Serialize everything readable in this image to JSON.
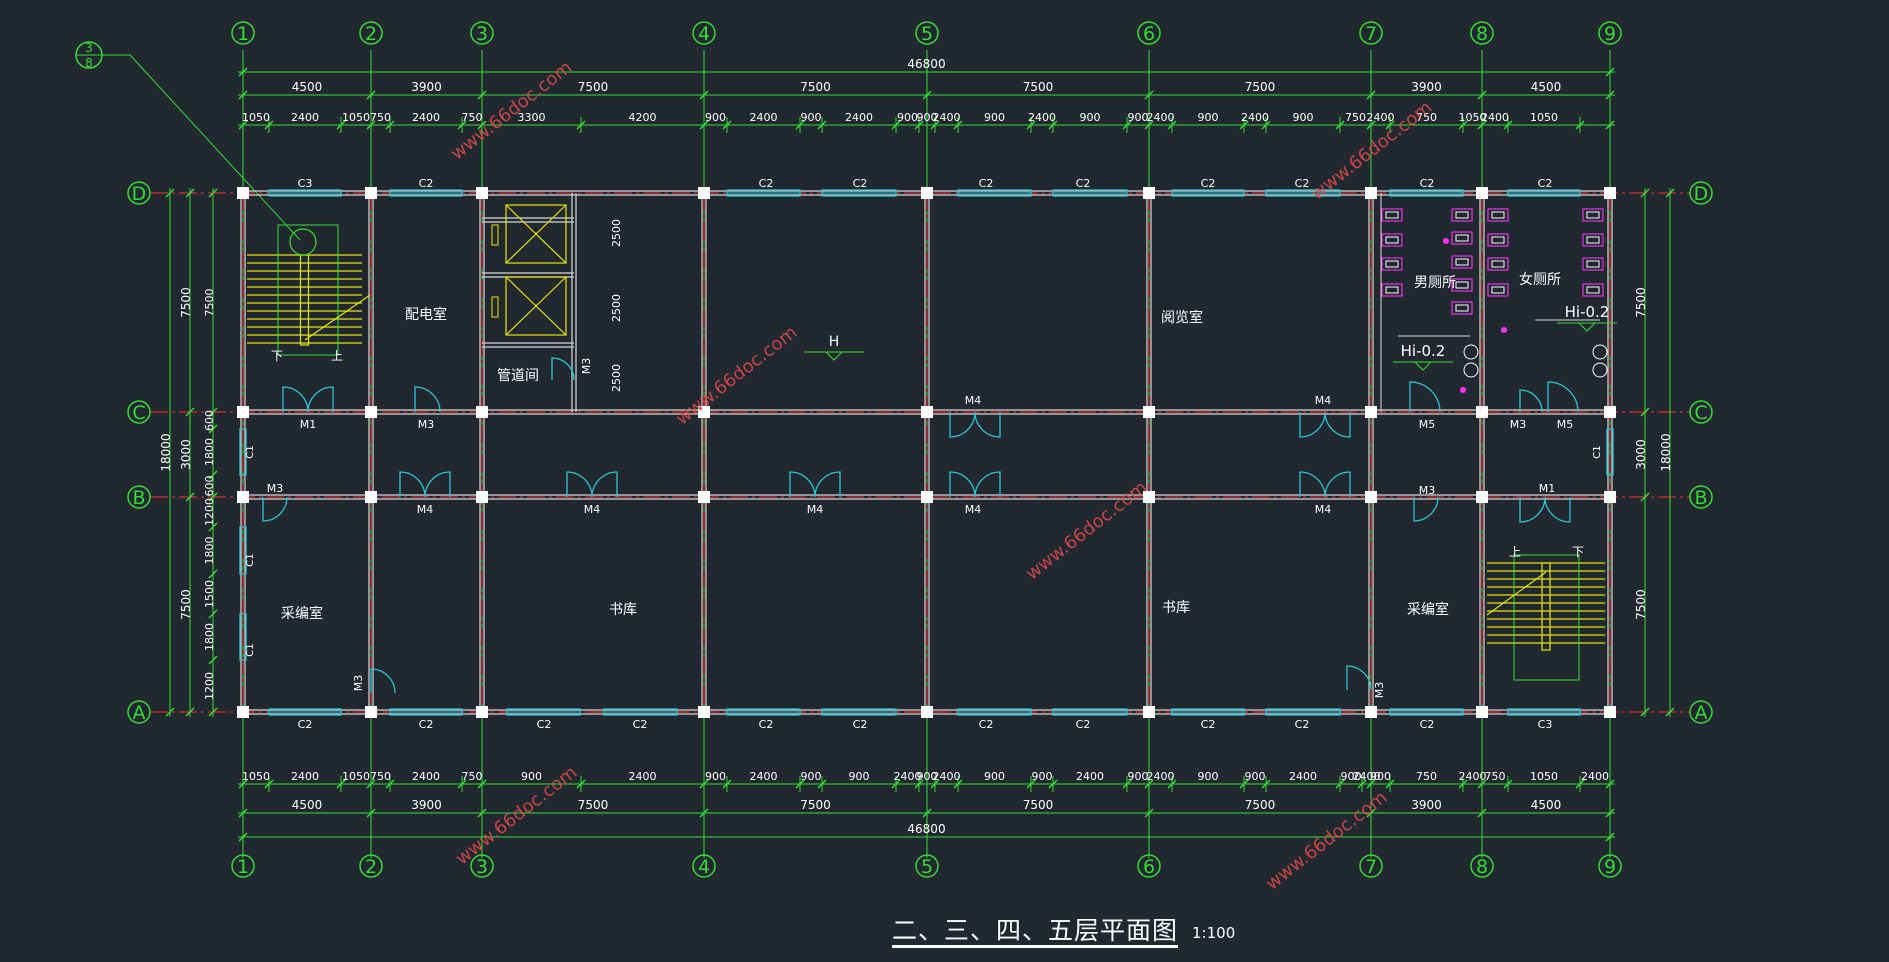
{
  "drawing": {
    "title": "二、三、四、五层平面图",
    "scale": "1:100",
    "section_mark": "3-8"
  },
  "grid_x_labels": [
    "1",
    "2",
    "3",
    "4",
    "5",
    "6",
    "7",
    "8",
    "9"
  ],
  "grid_y_labels": [
    "D",
    "C",
    "B",
    "A"
  ],
  "dims_top": {
    "total": "46800",
    "bays": [
      "4500",
      "3900",
      "7500",
      "7500",
      "7500",
      "7500",
      "3900",
      "4500"
    ],
    "details": [
      "1050",
      "2400",
      "1050",
      "750",
      "2400",
      "750",
      "3300",
      "4200",
      "900",
      "2400",
      "900",
      "2400",
      "900",
      "900",
      "2400",
      "900",
      "2400",
      "900",
      "900",
      "2400",
      "900",
      "2400",
      "900",
      "750",
      "2400",
      "750",
      "1050",
      "2400",
      "1050"
    ]
  },
  "dims_bottom": {
    "total": "46800",
    "bays": [
      "4500",
      "3900",
      "7500",
      "7500",
      "7500",
      "7500",
      "3900",
      "4500"
    ],
    "details": [
      "1050",
      "2400",
      "1050",
      "750",
      "2400",
      "750",
      "900",
      "2400",
      "900",
      "2400",
      "900",
      "900",
      "2400",
      "900",
      "2400",
      "900",
      "900",
      "2400",
      "900",
      "2400",
      "900",
      "900",
      "2400",
      "900",
      "2400",
      "900",
      "750",
      "2400",
      "750",
      "1050",
      "2400",
      "1050"
    ]
  },
  "dims_left": {
    "total": "18000",
    "bays": [
      "7500",
      "3000",
      "7500"
    ],
    "inner": [
      "7500",
      "600",
      "1800",
      "600",
      "1200",
      "1800",
      "1500",
      "1800",
      "1200"
    ]
  },
  "dims_right": {
    "total": "18000",
    "bays": [
      "7500",
      "3000",
      "7500"
    ]
  },
  "rooms": [
    "配电室",
    "管道间",
    "阅览室",
    "男厕所",
    "女厕所",
    "采编室",
    "书库",
    "书库",
    "采编室"
  ],
  "elevations": [
    "Hi-0.2",
    "Hi-0.2",
    "H"
  ],
  "stair_labels": [
    "下",
    "上",
    "上",
    "下"
  ],
  "elevator_dims": [
    "2500",
    "2500",
    "2500"
  ],
  "window_tags_top": [
    "C3",
    "C2",
    "C2",
    "C2",
    "C2",
    "C2",
    "C2",
    "C2",
    "C2",
    "C2",
    "C2"
  ],
  "window_tags_bottom": [
    "C2",
    "C2",
    "C2",
    "C2",
    "C2",
    "C2",
    "C2",
    "C2",
    "C2",
    "C2",
    "C2",
    "C3"
  ],
  "side_window_tags": [
    "C1",
    "C1",
    "C1",
    "C1"
  ],
  "door_tags": [
    "M1",
    "M3",
    "M4",
    "M4",
    "M5",
    "M3",
    "M5",
    "M3",
    "M4",
    "M4",
    "M4",
    "M4",
    "M4",
    "M3",
    "M1",
    "M3",
    "M3",
    "M3"
  ],
  "watermark": "www.66doc.com",
  "colors": {
    "background": "#212830",
    "grid_line": "#ff3030",
    "dimension": "#33dd33",
    "wall": "#d8d8d8",
    "window": "#29c6d6",
    "door": "#29c6d6",
    "stair": "#e6e600",
    "fixture": "#ff33ff",
    "watermark": "#d94a4a"
  }
}
